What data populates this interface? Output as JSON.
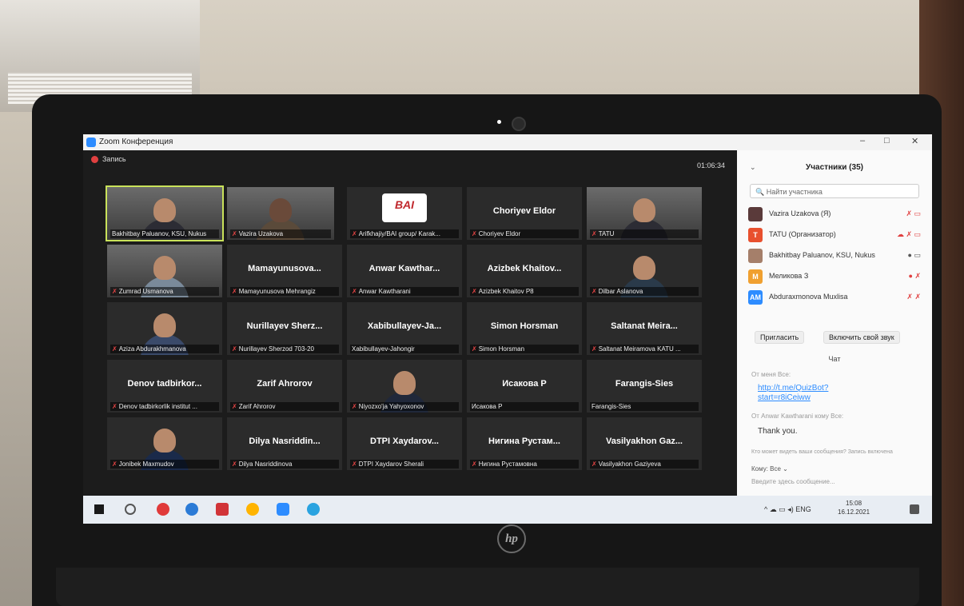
{
  "window": {
    "title": "Zoom Конференция",
    "recording": "Запись",
    "timer": "01:06:34"
  },
  "tiles": [
    {
      "big": "",
      "small": "Bakhitbay Paluanov, KSU, Nukus"
    },
    {
      "big": "",
      "small": "Vazira Uzakova"
    },
    {
      "big": "",
      "small": "Arifkhajiy/BAI group/ Karak..."
    },
    {
      "big": "Choriyev Eldor",
      "small": "Choriyev Eldor"
    },
    {
      "big": "",
      "small": "TATU"
    },
    {
      "big": "",
      "small": "Zumrad Usmanova"
    },
    {
      "big": "Mamayunusova...",
      "small": "Mamayunusova Mehrangiz"
    },
    {
      "big": "Anwar Kawthar...",
      "small": "Anwar Kawtharani"
    },
    {
      "big": "Azizbek Khaitov...",
      "small": "Azizbek Khaitov P8"
    },
    {
      "big": "",
      "small": "Dilbar Aslanova"
    },
    {
      "big": "",
      "small": "Aziza Abdurakhmanova"
    },
    {
      "big": "Nurillayev Sherz...",
      "small": "Nurillayev Sherzod 703-20"
    },
    {
      "big": "Xabibullayev-Ja...",
      "small": "Xabibullayev-Jahongir"
    },
    {
      "big": "Simon Horsman",
      "small": "Simon Horsman"
    },
    {
      "big": "Saltanat Meira...",
      "small": "Saltanat Meiramova KATU ..."
    },
    {
      "big": "Denov tadbirkor...",
      "small": "Denov tadbirkorlik institut ..."
    },
    {
      "big": "Zarif Ahrorov",
      "small": "Zarif Ahrorov"
    },
    {
      "big": "",
      "small": "Niyozxo'ja Yahyoxonov"
    },
    {
      "big": "Исакова Р",
      "small": "Исакова Р"
    },
    {
      "big": "Farangis-Sies",
      "small": "Farangis-Sies"
    },
    {
      "big": "",
      "small": "Jonibek Maxmudov"
    },
    {
      "big": "Dilya Nasriddin...",
      "small": "Dilya Nasriddinova"
    },
    {
      "big": "DTPI Xaydarov...",
      "small": "DTPI Xaydarov Sherali"
    },
    {
      "big": "Нигина Рустам...",
      "small": "Нигина Рустамовна"
    },
    {
      "big": "Vasilyakhon Gaz...",
      "small": "Vasilyakhon Gaziyeva"
    }
  ],
  "bai_logo": "BAI",
  "panel": {
    "title": "Участники (35)",
    "search_placeholder": "Найти участника",
    "participants": [
      {
        "initial": "",
        "name": "Vazira Uzakova (Я)",
        "color": "#5a3a3a"
      },
      {
        "initial": "T",
        "name": "TATU (Организатор)",
        "color": "#e8502e"
      },
      {
        "initial": "",
        "name": "Bakhitbay Paluanov, KSU, Nukus",
        "color": "#a57f6a"
      },
      {
        "initial": "M",
        "name": "Меликова З",
        "color": "#f0a030"
      },
      {
        "initial": "AM",
        "name": "Abduraxmonova Muxlisa",
        "color": "#2d8cff"
      }
    ],
    "invite": "Пригласить",
    "unmute": "Включить свой звук",
    "chat_title": "Чат",
    "chat_from1": "От меня Все:",
    "chat_link": "http://t.me/QuizBot?start=r8iCeiww",
    "chat_from2": "От Anwar Kawtharani кому Все:",
    "chat_msg": "Thank you.",
    "chat_notice": "Кто может видеть ваши сообщения? Запись включена",
    "to_label": "Кому:",
    "to_value": "Все",
    "input_placeholder": "Введите здесь сообщение..."
  },
  "taskbar": {
    "lang": "ENG",
    "time": "15:08",
    "date": "16.12.2021"
  }
}
